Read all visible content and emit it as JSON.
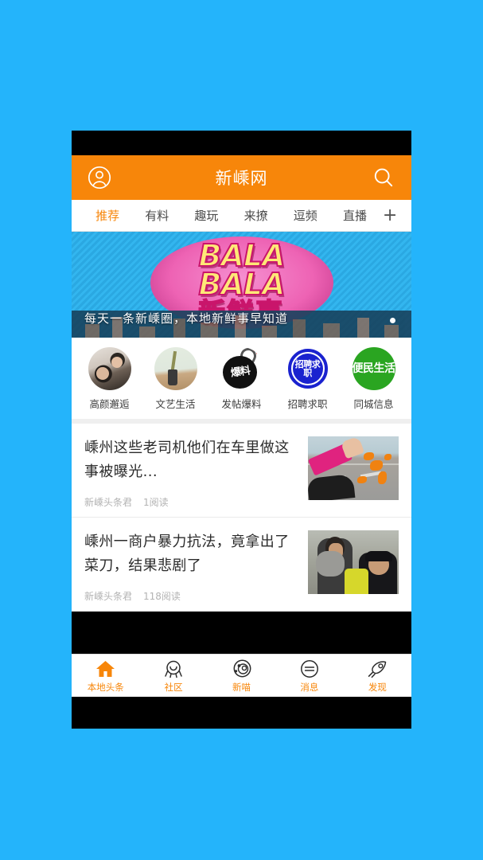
{
  "page": {
    "background_color": "#24b4fb",
    "accent_color": "#f7860a"
  },
  "header": {
    "title": "新嵊网",
    "avatar_icon": "user-avatar-icon",
    "search_icon": "search-icon"
  },
  "tabs": {
    "items": [
      {
        "label": "推荐",
        "active": true
      },
      {
        "label": "有料",
        "active": false
      },
      {
        "label": "趣玩",
        "active": false
      },
      {
        "label": "来撩",
        "active": false
      },
      {
        "label": "逗频",
        "active": false
      },
      {
        "label": "直播",
        "active": false
      }
    ],
    "add_label": "+"
  },
  "banner": {
    "logo_line1": "BALA",
    "logo_line2": "BALA",
    "logo_cn": "新鲜事",
    "caption": "每天一条新嵊圈，本地新鲜事早知道",
    "indicator_count": 1,
    "indicator_active": 0
  },
  "categories": [
    {
      "label": "高颜邂逅",
      "icon": "couple-photo-icon"
    },
    {
      "label": "文艺生活",
      "icon": "vase-flowers-photo-icon"
    },
    {
      "label": "发帖爆料",
      "icon": "bomb-icon",
      "icon_text": "爆料"
    },
    {
      "label": "招聘求职",
      "icon": "job-circle-icon",
      "icon_text": "招聘求职"
    },
    {
      "label": "同城信息",
      "icon": "green-life-circle-icon",
      "icon_text": "便民生活"
    }
  ],
  "news": [
    {
      "title": "嵊州这些老司机他们在车里做这事被曝光...",
      "source": "新嵊头条君",
      "reads": "1阅读",
      "thumb": "car-window-throwing-peel-photo"
    },
    {
      "title": "嵊州一商户暴力抗法，竟拿出了菜刀，结果悲剧了",
      "source": "新嵊头条君",
      "reads": "118阅读",
      "thumb": "police-restraining-man-photo"
    }
  ],
  "bottom_nav": [
    {
      "label": "本地头条",
      "icon": "home-icon",
      "active": true
    },
    {
      "label": "社区",
      "icon": "community-icon",
      "active": false
    },
    {
      "label": "新喵",
      "icon": "cat-atom-icon",
      "active": false
    },
    {
      "label": "消息",
      "icon": "message-icon",
      "active": false
    },
    {
      "label": "发现",
      "icon": "rocket-discover-icon",
      "active": false
    }
  ]
}
